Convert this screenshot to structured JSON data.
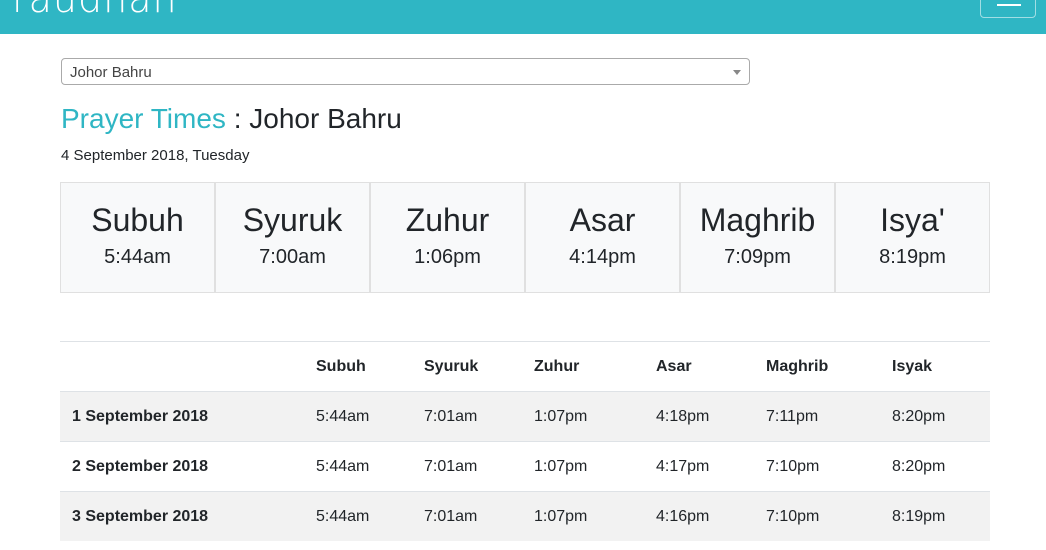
{
  "header": {
    "logo_text": "raudhah",
    "brand_color": "#2fb6c4",
    "menu_icon": "hamburger-icon"
  },
  "location_select": {
    "selected": "Johor Bahru"
  },
  "heading": {
    "title_accent": "Prayer Times",
    "separator": " : ",
    "city": "Johor Bahru",
    "date": "4 September 2018, Tuesday"
  },
  "today": [
    {
      "name": "Subuh",
      "time": "5:44am"
    },
    {
      "name": "Syuruk",
      "time": "7:00am"
    },
    {
      "name": "Zuhur",
      "time": "1:06pm"
    },
    {
      "name": "Asar",
      "time": "4:14pm"
    },
    {
      "name": "Maghrib",
      "time": "7:09pm"
    },
    {
      "name": "Isya'",
      "time": "8:19pm"
    }
  ],
  "schedule": {
    "columns": [
      "",
      "Subuh",
      "Syuruk",
      "Zuhur",
      "Asar",
      "Maghrib",
      "Isyak"
    ],
    "rows": [
      {
        "date": "1 September 2018",
        "subuh": "5:44am",
        "syuruk": "7:01am",
        "zuhur": "1:07pm",
        "asar": "4:18pm",
        "maghrib": "7:11pm",
        "isyak": "8:20pm"
      },
      {
        "date": "2 September 2018",
        "subuh": "5:44am",
        "syuruk": "7:01am",
        "zuhur": "1:07pm",
        "asar": "4:17pm",
        "maghrib": "7:10pm",
        "isyak": "8:20pm"
      },
      {
        "date": "3 September 2018",
        "subuh": "5:44am",
        "syuruk": "7:01am",
        "zuhur": "1:07pm",
        "asar": "4:16pm",
        "maghrib": "7:10pm",
        "isyak": "8:19pm"
      }
    ]
  }
}
